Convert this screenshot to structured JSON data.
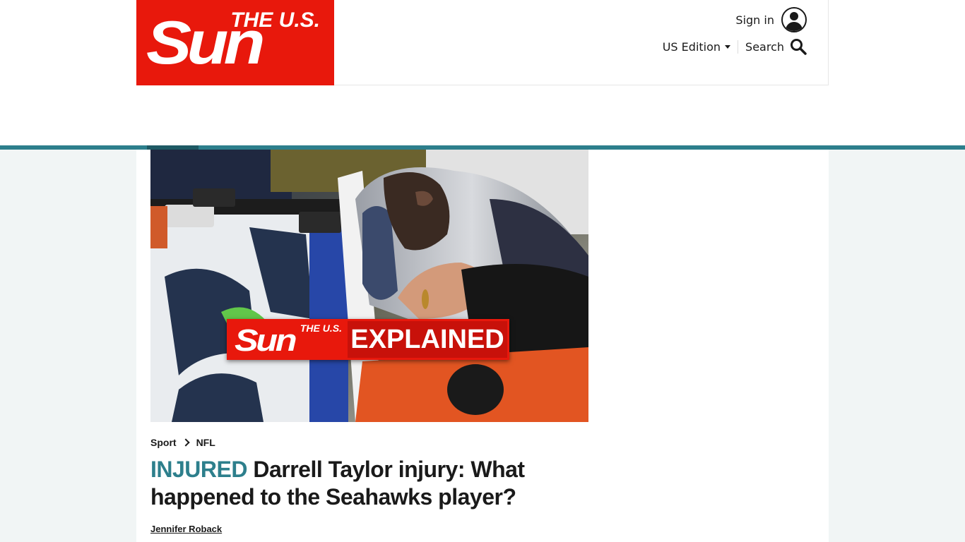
{
  "header": {
    "logo": {
      "top": "THE U.S.",
      "main": "Sun"
    },
    "sign_in": "Sign in",
    "edition": "US Edition",
    "search": "Search"
  },
  "hero": {
    "badge": {
      "logo_top": "THE U.S.",
      "logo_main": "Sun",
      "text": "EXPLAINED"
    }
  },
  "breadcrumb": [
    "Sport",
    "NFL"
  ],
  "article": {
    "kicker": "INJURED",
    "headline": "Darrell Taylor injury: What happened to the Seahawks player?",
    "author": "Jennifer Roback"
  },
  "colors": {
    "brand_red": "#e8180c",
    "accent_teal": "#2d7f8c",
    "page_background": "#f1f5f5"
  },
  "icons": [
    "user-avatar-icon",
    "caret-down-icon",
    "search-icon",
    "chevron-right-icon"
  ]
}
